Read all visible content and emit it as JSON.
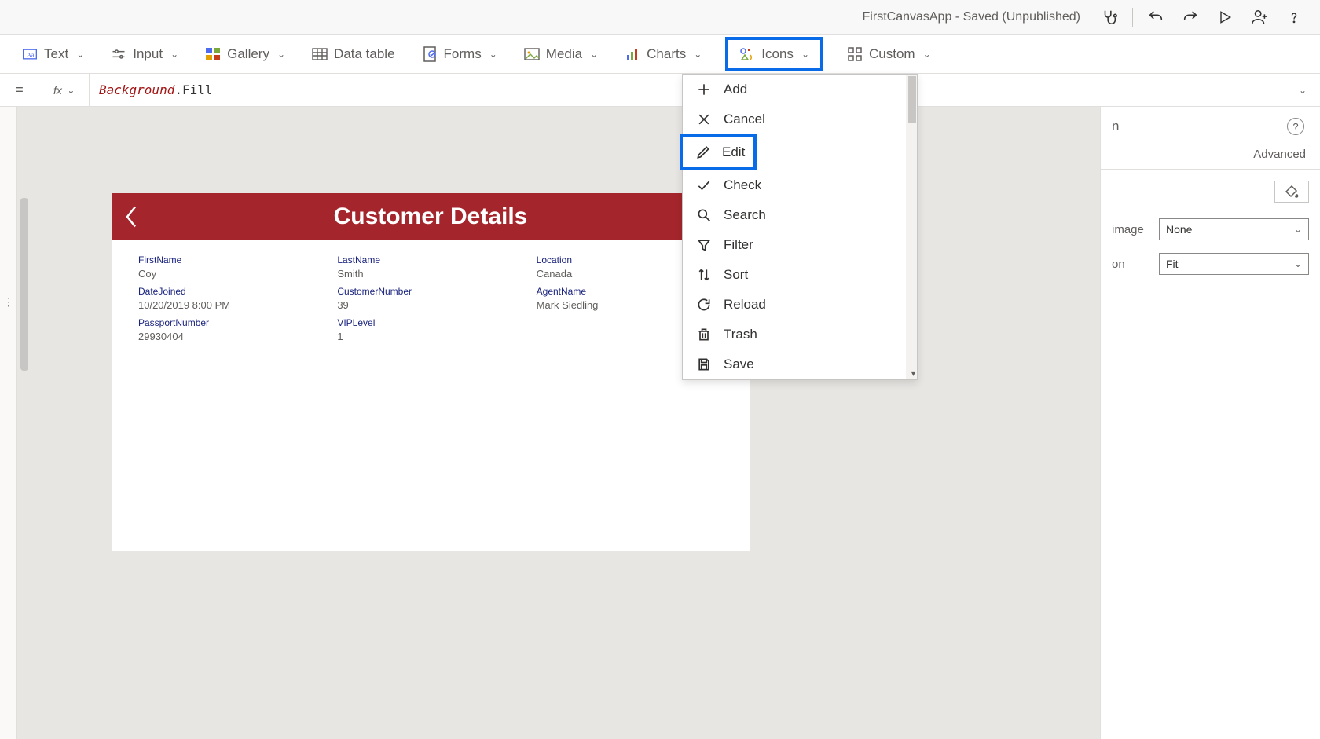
{
  "title": "FirstCanvasApp - Saved (Unpublished)",
  "ribbon": {
    "text": "Text",
    "input": "Input",
    "gallery": "Gallery",
    "datatable": "Data table",
    "forms": "Forms",
    "media": "Media",
    "charts": "Charts",
    "icons": "Icons",
    "custom": "Custom"
  },
  "formula": {
    "eq": "=",
    "fx": "fx",
    "identifier": "Background",
    "prop": ".Fill"
  },
  "iconsDropdown": [
    {
      "icon": "plus",
      "label": "Add"
    },
    {
      "icon": "x",
      "label": "Cancel"
    },
    {
      "icon": "pencil",
      "label": "Edit"
    },
    {
      "icon": "check",
      "label": "Check"
    },
    {
      "icon": "search",
      "label": "Search"
    },
    {
      "icon": "filter",
      "label": "Filter"
    },
    {
      "icon": "sort",
      "label": "Sort"
    },
    {
      "icon": "reload",
      "label": "Reload"
    },
    {
      "icon": "trash",
      "label": "Trash"
    },
    {
      "icon": "save",
      "label": "Save"
    }
  ],
  "screen": {
    "title": "Customer Details",
    "fields": [
      {
        "label": "FirstName",
        "value": "Coy"
      },
      {
        "label": "LastName",
        "value": "Smith"
      },
      {
        "label": "Location",
        "value": "Canada"
      },
      {
        "label": "DateJoined",
        "value": "10/20/2019 8:00 PM"
      },
      {
        "label": "CustomerNumber",
        "value": "39"
      },
      {
        "label": "AgentName",
        "value": "Mark Siedling"
      },
      {
        "label": "PassportNumber",
        "value": "29930404"
      },
      {
        "label": "VIPLevel",
        "value": "1"
      }
    ]
  },
  "properties": {
    "heading": "n",
    "tab_advanced": "Advanced",
    "image_label": "image",
    "image_value": "None",
    "pos_label": "on",
    "pos_value": "Fit"
  }
}
